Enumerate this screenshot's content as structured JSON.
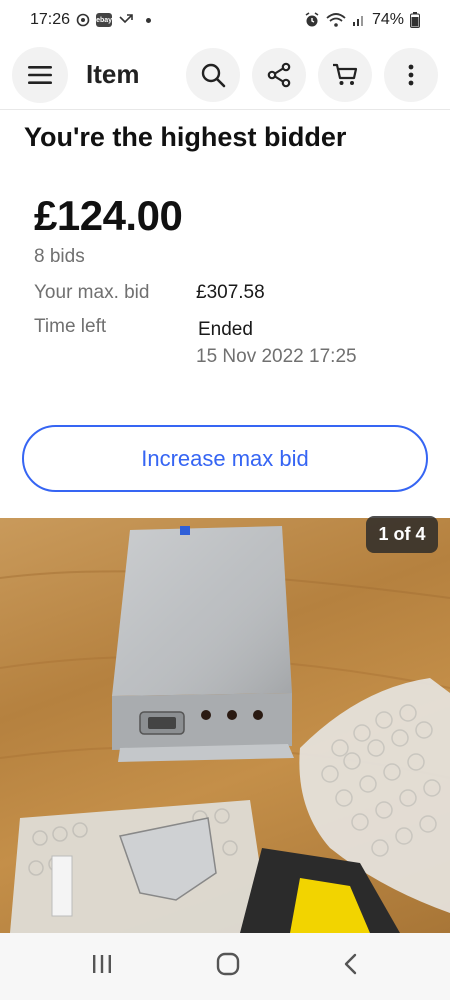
{
  "status_bar": {
    "time": "17:26",
    "battery": "74%"
  },
  "app_bar": {
    "title": "Item"
  },
  "bid": {
    "headline": "You're the highest bidder",
    "price": "£124.00",
    "bids": "8 bids",
    "max_bid_label": "Your max. bid",
    "max_bid_value": "£307.58",
    "time_left_label": "Time left",
    "time_left_value": "Ended",
    "end_datetime": "15 Nov 2022 17:25"
  },
  "actions": {
    "increase_label": "Increase max bid"
  },
  "gallery": {
    "counter": "1 of 4"
  },
  "colors": {
    "accent": "#3665f3",
    "text": "#191919",
    "secondary": "#707070"
  }
}
